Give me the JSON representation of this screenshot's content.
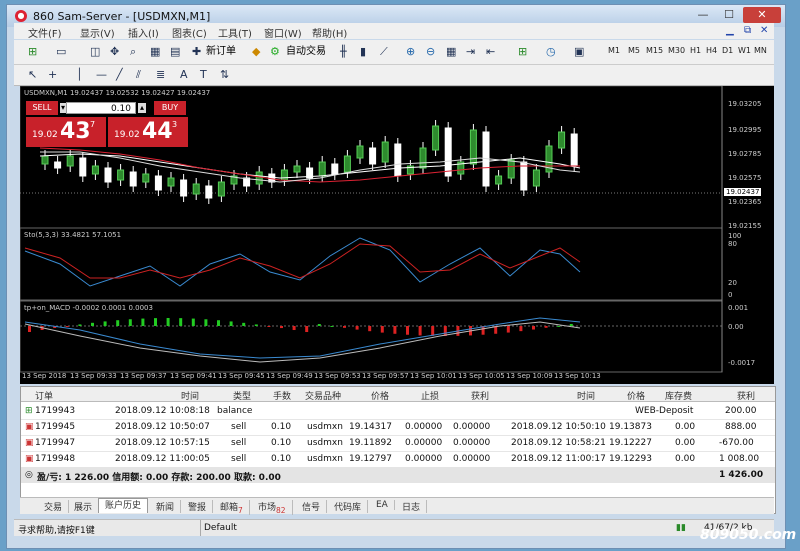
{
  "window": {
    "title": "860      Sam-Server - [USDMXN,M1]",
    "controls": {
      "minimize": "—",
      "maximize": "☐",
      "close": "✕"
    }
  },
  "menu": [
    "文件(F)",
    "显示(V)",
    "插入(I)",
    "图表(C)",
    "工具(T)",
    "窗口(W)",
    "帮助(H)"
  ],
  "toolbar": {
    "new_order": "新订单",
    "auto_trading": "自动交易",
    "timeframes": [
      "M1",
      "M5",
      "M15",
      "M30",
      "H1",
      "H4",
      "D1",
      "W1",
      "MN"
    ]
  },
  "chart": {
    "title": "USDMXN,M1  19.02437 19.02532 19.02427 19.02437",
    "price_labels": [
      "19.03205",
      "19.02995",
      "19.02785",
      "19.02575",
      "19.02437",
      "19.02365",
      "19.02155"
    ],
    "stoch_label": "Sto(5,3,3) 33.4821 57.1051",
    "stoch_levels": [
      "100",
      "80",
      "20",
      "0"
    ],
    "macd_label": "tp+on_MACD -0.0002 0.0001 0.0003",
    "macd_levels": [
      "0.001",
      "0.00",
      "-0.0017"
    ],
    "time_labels": [
      "13 Sep 2018",
      "13 Sep 09:33",
      "13 Sep 09:37",
      "13 Sep 09:41",
      "13 Sep 09:45",
      "13 Sep 09:49",
      "13 Sep 09:53",
      "13 Sep 09:57",
      "13 Sep 10:01",
      "13 Sep 10:05",
      "13 Sep 10:09",
      "13 Sep 10:13"
    ]
  },
  "one_click": {
    "sell_label": "SELL",
    "buy_label": "BUY",
    "lot": "0.10",
    "sell_quote_prefix": "19.02",
    "sell_quote_big": "43",
    "sell_quote_sup": "7",
    "buy_quote_prefix": "19.02",
    "buy_quote_big": "44",
    "buy_quote_sup": "3"
  },
  "terminal": {
    "headers": [
      "订单",
      "时间",
      "类型",
      "手数",
      "交易品种",
      "价格",
      "止损",
      "获利",
      "时间",
      "价格",
      "库存费",
      "获利"
    ],
    "rows": [
      {
        "order": "1719943",
        "time": "2018.09.12 10:08:18",
        "type": "balance",
        "lots": "",
        "symbol": "",
        "price": "",
        "sl": "",
        "tp": "",
        "close_time": "",
        "close_price": "WEB-Deposit",
        "swap": "",
        "profit": "200.00"
      },
      {
        "order": "1719945",
        "time": "2018.09.12 10:50:07",
        "type": "sell",
        "lots": "0.10",
        "symbol": "usdmxn",
        "price": "19.14317",
        "sl": "0.00000",
        "tp": "0.00000",
        "close_time": "2018.09.12 10:50:10",
        "close_price": "19.13873",
        "swap": "0.00",
        "profit": "888.00"
      },
      {
        "order": "1719947",
        "time": "2018.09.12 10:57:15",
        "type": "sell",
        "lots": "0.10",
        "symbol": "usdmxn",
        "price": "19.11892",
        "sl": "0.00000",
        "tp": "0.00000",
        "close_time": "2018.09.12 10:58:21",
        "close_price": "19.12227",
        "swap": "0.00",
        "profit": "-670.00"
      },
      {
        "order": "1719948",
        "time": "2018.09.12 11:00:05",
        "type": "sell",
        "lots": "0.10",
        "symbol": "usdmxn",
        "price": "19.12797",
        "sl": "0.00000",
        "tp": "0.00000",
        "close_time": "2018.09.12 11:00:17",
        "close_price": "19.12293",
        "swap": "0.00",
        "profit": "1 008.00"
      }
    ],
    "summary": "盈/亏: 1 226.00  信用额: 0.00  存款: 200.00  取款: 0.00",
    "summary_total": "1 426.00"
  },
  "tabs": [
    {
      "label": "交易",
      "badge": ""
    },
    {
      "label": "展示",
      "badge": ""
    },
    {
      "label": "账户历史",
      "badge": "",
      "active": true
    },
    {
      "label": "新闻",
      "badge": ""
    },
    {
      "label": "警报",
      "badge": ""
    },
    {
      "label": "邮箱",
      "badge": "7"
    },
    {
      "label": "市场",
      "badge": "82"
    },
    {
      "label": "信号",
      "badge": ""
    },
    {
      "label": "代码库",
      "badge": ""
    },
    {
      "label": "EA",
      "badge": ""
    },
    {
      "label": "日志",
      "badge": ""
    }
  ],
  "status": {
    "help": "寻求帮助,请按F1键",
    "profile": "Default",
    "conn": "41/67/2 kb"
  },
  "watermark": "809050.com",
  "colors": {
    "accent_red": "#c8212a",
    "bull": "#ffffff",
    "bear": "#2e8b2e"
  }
}
